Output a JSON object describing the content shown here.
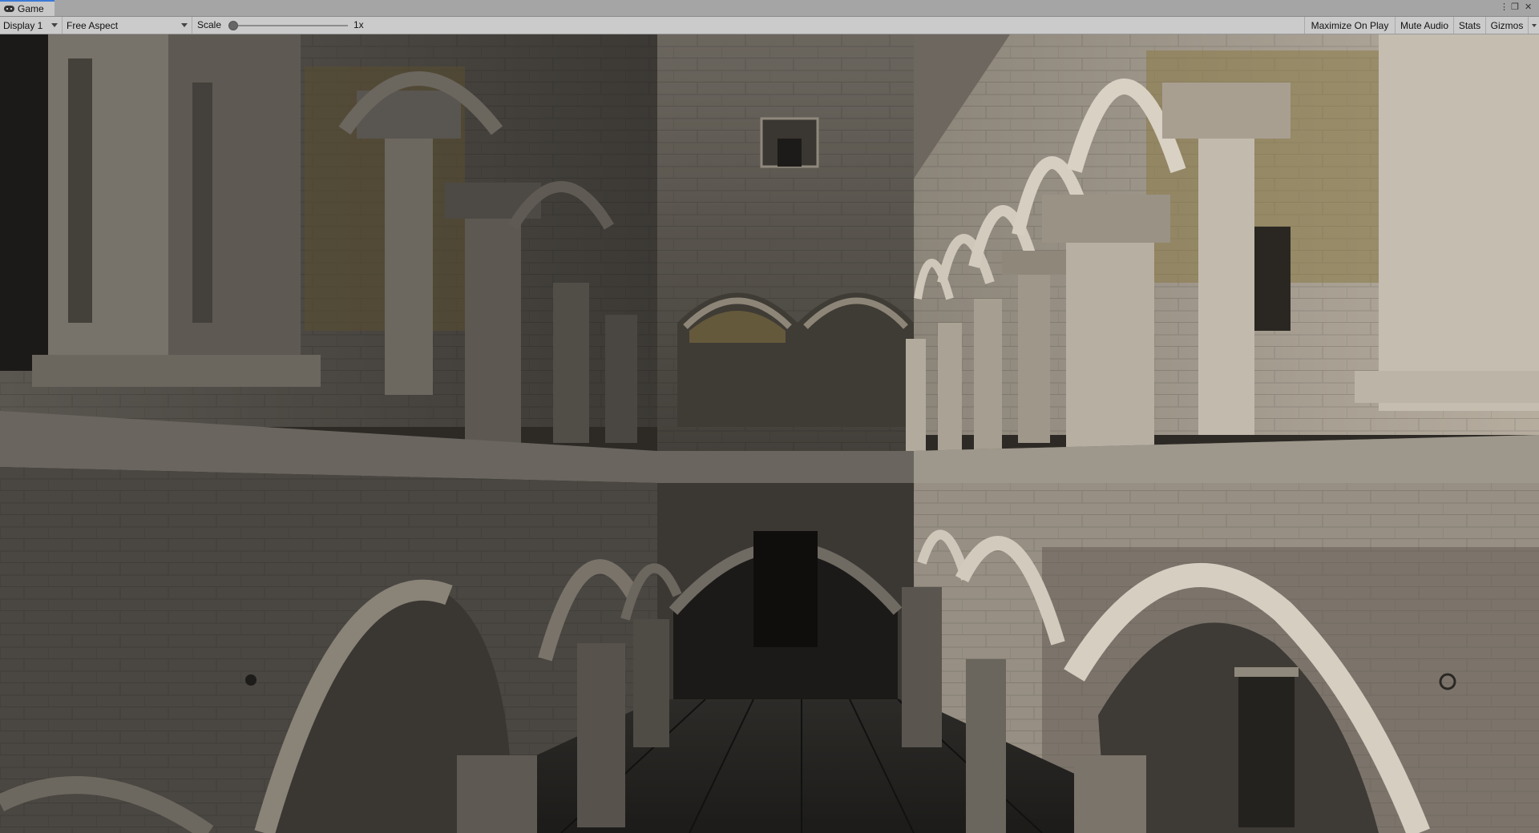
{
  "window": {
    "tab_label": "Game",
    "tab_icon": "gamepad-icon"
  },
  "toolbar": {
    "display_select": "Display 1",
    "aspect_select": "Free Aspect",
    "scale_label": "Scale",
    "scale_value": "1x",
    "scale_slider_fraction": 0.0,
    "maximize_on_play": "Maximize On Play",
    "mute_audio": "Mute Audio",
    "stats": "Stats",
    "gizmos": "Gizmos"
  },
  "viewport": {
    "scene": "rendered courtyard with stone arcades",
    "colors": {
      "shadow": "#2b2824",
      "stone_lit": "#b9b1a4",
      "stone_mid": "#6f6a62",
      "warm_ceiling": "#8a7a45",
      "floor": "#262422"
    }
  }
}
